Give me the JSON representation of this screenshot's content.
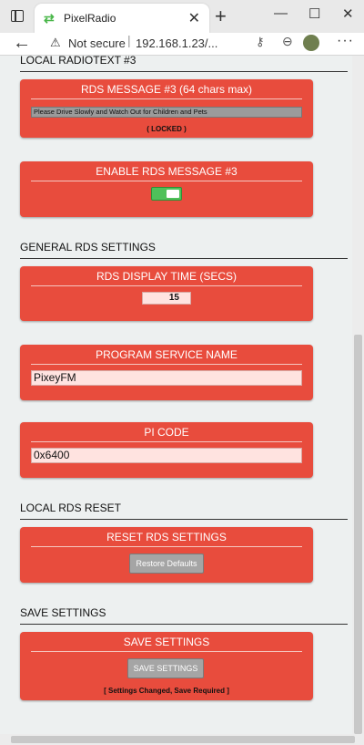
{
  "browser": {
    "tab_title": "PixelRadio",
    "not_secure": "Not secure",
    "url": "192.168.1.23/...",
    "favicon": "⇄",
    "tab_close": "✕",
    "new_tab": "+"
  },
  "sections": {
    "local_radiotext": "LOCAL RADIOTEXT #3",
    "general_rds": "GENERAL RDS SETTINGS",
    "local_rds_reset": "LOCAL RDS RESET",
    "save_settings": "SAVE SETTINGS"
  },
  "rds_message": {
    "title": "RDS MESSAGE #3 (64 chars max)",
    "value": "Please Drive Slowly and Watch Out for Children and Pets",
    "status": "( LOCKED )"
  },
  "enable_rds": {
    "title": "ENABLE RDS MESSAGE #3",
    "enabled": true
  },
  "display_time": {
    "title": "RDS DISPLAY TIME (SECS)",
    "value": "15"
  },
  "program_service": {
    "title": "PROGRAM SERVICE NAME",
    "value": "PixeyFM"
  },
  "pi_code": {
    "title": "PI CODE",
    "value": "0x6400"
  },
  "reset": {
    "title": "RESET RDS SETTINGS",
    "button": "Restore Defaults"
  },
  "save": {
    "title": "SAVE SETTINGS",
    "button": "SAVE SETTINGS",
    "status": "[ Settings Changed, Save Required ]"
  },
  "colors": {
    "card": "#e84c3d",
    "toggle_on": "#4fc15a",
    "page_bg": "#edf0f0"
  }
}
